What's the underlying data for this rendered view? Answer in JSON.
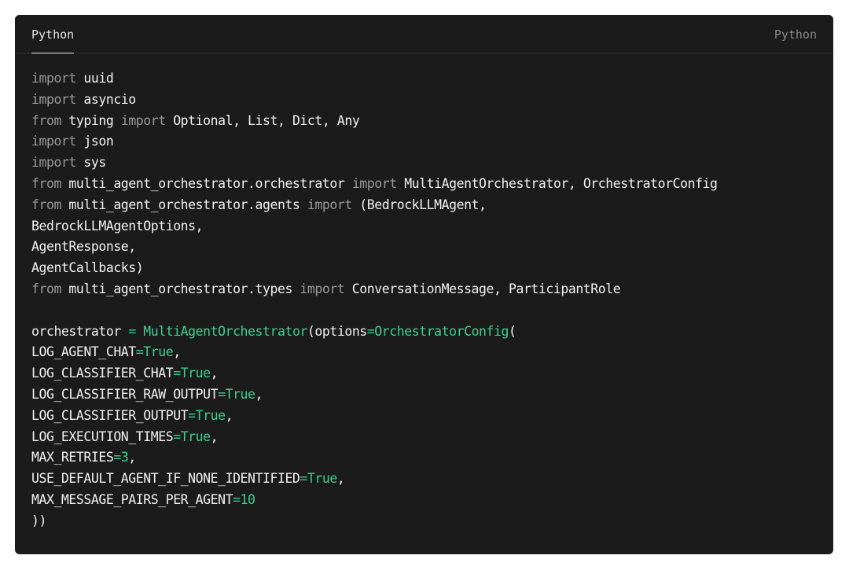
{
  "header": {
    "tab_label": "Python",
    "language_label": "Python"
  },
  "colors": {
    "background": "#1b1b1b",
    "keyword": "#9a9a9a",
    "accent_green": "#3ecf8e",
    "text": "#f2f2f2"
  },
  "code": {
    "lines": [
      [
        {
          "t": "kw",
          "v": "import"
        },
        {
          "t": "plain",
          "v": " uuid"
        }
      ],
      [
        {
          "t": "kw",
          "v": "import"
        },
        {
          "t": "plain",
          "v": " asyncio"
        }
      ],
      [
        {
          "t": "kw",
          "v": "from"
        },
        {
          "t": "plain",
          "v": " typing "
        },
        {
          "t": "kw",
          "v": "import"
        },
        {
          "t": "plain",
          "v": " Optional, List, Dict, Any"
        }
      ],
      [
        {
          "t": "kw",
          "v": "import"
        },
        {
          "t": "plain",
          "v": " json"
        }
      ],
      [
        {
          "t": "kw",
          "v": "import"
        },
        {
          "t": "plain",
          "v": " sys"
        }
      ],
      [
        {
          "t": "kw",
          "v": "from"
        },
        {
          "t": "plain",
          "v": " multi_agent_orchestrator.orchestrator "
        },
        {
          "t": "kw",
          "v": "import"
        },
        {
          "t": "plain",
          "v": " MultiAgentOrchestrator, OrchestratorConfig"
        }
      ],
      [
        {
          "t": "kw",
          "v": "from"
        },
        {
          "t": "plain",
          "v": " multi_agent_orchestrator.agents "
        },
        {
          "t": "kw",
          "v": "import"
        },
        {
          "t": "plain",
          "v": " (BedrockLLMAgent,"
        }
      ],
      [
        {
          "t": "plain",
          "v": "BedrockLLMAgentOptions,"
        }
      ],
      [
        {
          "t": "plain",
          "v": "AgentResponse,"
        }
      ],
      [
        {
          "t": "plain",
          "v": "AgentCallbacks)"
        }
      ],
      [
        {
          "t": "kw",
          "v": "from"
        },
        {
          "t": "plain",
          "v": " multi_agent_orchestrator.types "
        },
        {
          "t": "kw",
          "v": "import"
        },
        {
          "t": "plain",
          "v": " ConversationMessage, ParticipantRole"
        }
      ],
      [],
      [
        {
          "t": "plain",
          "v": "orchestrator "
        },
        {
          "t": "op",
          "v": "="
        },
        {
          "t": "plain",
          "v": " "
        },
        {
          "t": "fn",
          "v": "MultiAgentOrchestrator"
        },
        {
          "t": "plain",
          "v": "(options"
        },
        {
          "t": "op",
          "v": "="
        },
        {
          "t": "fn",
          "v": "OrchestratorConfig"
        },
        {
          "t": "plain",
          "v": "("
        }
      ],
      [
        {
          "t": "plain",
          "v": "LOG_AGENT_CHAT"
        },
        {
          "t": "op",
          "v": "="
        },
        {
          "t": "fn",
          "v": "True"
        },
        {
          "t": "plain",
          "v": ","
        }
      ],
      [
        {
          "t": "plain",
          "v": "LOG_CLASSIFIER_CHAT"
        },
        {
          "t": "op",
          "v": "="
        },
        {
          "t": "fn",
          "v": "True"
        },
        {
          "t": "plain",
          "v": ","
        }
      ],
      [
        {
          "t": "plain",
          "v": "LOG_CLASSIFIER_RAW_OUTPUT"
        },
        {
          "t": "op",
          "v": "="
        },
        {
          "t": "fn",
          "v": "True"
        },
        {
          "t": "plain",
          "v": ","
        }
      ],
      [
        {
          "t": "plain",
          "v": "LOG_CLASSIFIER_OUTPUT"
        },
        {
          "t": "op",
          "v": "="
        },
        {
          "t": "fn",
          "v": "True"
        },
        {
          "t": "plain",
          "v": ","
        }
      ],
      [
        {
          "t": "plain",
          "v": "LOG_EXECUTION_TIMES"
        },
        {
          "t": "op",
          "v": "="
        },
        {
          "t": "fn",
          "v": "True"
        },
        {
          "t": "plain",
          "v": ","
        }
      ],
      [
        {
          "t": "plain",
          "v": "MAX_RETRIES"
        },
        {
          "t": "op",
          "v": "="
        },
        {
          "t": "num",
          "v": "3"
        },
        {
          "t": "plain",
          "v": ","
        }
      ],
      [
        {
          "t": "plain",
          "v": "USE_DEFAULT_AGENT_IF_NONE_IDENTIFIED"
        },
        {
          "t": "op",
          "v": "="
        },
        {
          "t": "fn",
          "v": "True"
        },
        {
          "t": "plain",
          "v": ","
        }
      ],
      [
        {
          "t": "plain",
          "v": "MAX_MESSAGE_PAIRS_PER_AGENT"
        },
        {
          "t": "op",
          "v": "="
        },
        {
          "t": "num",
          "v": "10"
        }
      ],
      [
        {
          "t": "plain",
          "v": "))"
        }
      ]
    ]
  }
}
